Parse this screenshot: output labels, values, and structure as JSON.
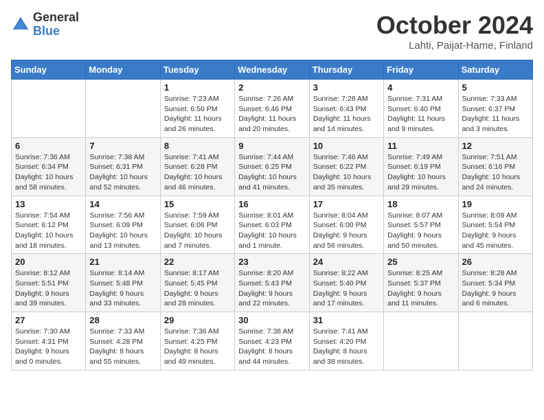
{
  "logo": {
    "general": "General",
    "blue": "Blue"
  },
  "header": {
    "month": "October 2024",
    "location": "Lahti, Paijat-Hame, Finland"
  },
  "weekdays": [
    "Sunday",
    "Monday",
    "Tuesday",
    "Wednesday",
    "Thursday",
    "Friday",
    "Saturday"
  ],
  "weeks": [
    [
      {
        "day": "",
        "info": ""
      },
      {
        "day": "",
        "info": ""
      },
      {
        "day": "1",
        "info": "Sunrise: 7:23 AM\nSunset: 6:50 PM\nDaylight: 11 hours and 26 minutes."
      },
      {
        "day": "2",
        "info": "Sunrise: 7:26 AM\nSunset: 6:46 PM\nDaylight: 11 hours and 20 minutes."
      },
      {
        "day": "3",
        "info": "Sunrise: 7:28 AM\nSunset: 6:43 PM\nDaylight: 11 hours and 14 minutes."
      },
      {
        "day": "4",
        "info": "Sunrise: 7:31 AM\nSunset: 6:40 PM\nDaylight: 11 hours and 9 minutes."
      },
      {
        "day": "5",
        "info": "Sunrise: 7:33 AM\nSunset: 6:37 PM\nDaylight: 11 hours and 3 minutes."
      }
    ],
    [
      {
        "day": "6",
        "info": "Sunrise: 7:36 AM\nSunset: 6:34 PM\nDaylight: 10 hours and 58 minutes."
      },
      {
        "day": "7",
        "info": "Sunrise: 7:38 AM\nSunset: 6:31 PM\nDaylight: 10 hours and 52 minutes."
      },
      {
        "day": "8",
        "info": "Sunrise: 7:41 AM\nSunset: 6:28 PM\nDaylight: 10 hours and 46 minutes."
      },
      {
        "day": "9",
        "info": "Sunrise: 7:44 AM\nSunset: 6:25 PM\nDaylight: 10 hours and 41 minutes."
      },
      {
        "day": "10",
        "info": "Sunrise: 7:46 AM\nSunset: 6:22 PM\nDaylight: 10 hours and 35 minutes."
      },
      {
        "day": "11",
        "info": "Sunrise: 7:49 AM\nSunset: 6:19 PM\nDaylight: 10 hours and 29 minutes."
      },
      {
        "day": "12",
        "info": "Sunrise: 7:51 AM\nSunset: 6:16 PM\nDaylight: 10 hours and 24 minutes."
      }
    ],
    [
      {
        "day": "13",
        "info": "Sunrise: 7:54 AM\nSunset: 6:12 PM\nDaylight: 10 hours and 18 minutes."
      },
      {
        "day": "14",
        "info": "Sunrise: 7:56 AM\nSunset: 6:09 PM\nDaylight: 10 hours and 13 minutes."
      },
      {
        "day": "15",
        "info": "Sunrise: 7:59 AM\nSunset: 6:06 PM\nDaylight: 10 hours and 7 minutes."
      },
      {
        "day": "16",
        "info": "Sunrise: 8:01 AM\nSunset: 6:03 PM\nDaylight: 10 hours and 1 minute."
      },
      {
        "day": "17",
        "info": "Sunrise: 8:04 AM\nSunset: 6:00 PM\nDaylight: 9 hours and 56 minutes."
      },
      {
        "day": "18",
        "info": "Sunrise: 8:07 AM\nSunset: 5:57 PM\nDaylight: 9 hours and 50 minutes."
      },
      {
        "day": "19",
        "info": "Sunrise: 8:09 AM\nSunset: 5:54 PM\nDaylight: 9 hours and 45 minutes."
      }
    ],
    [
      {
        "day": "20",
        "info": "Sunrise: 8:12 AM\nSunset: 5:51 PM\nDaylight: 9 hours and 39 minutes."
      },
      {
        "day": "21",
        "info": "Sunrise: 8:14 AM\nSunset: 5:48 PM\nDaylight: 9 hours and 33 minutes."
      },
      {
        "day": "22",
        "info": "Sunrise: 8:17 AM\nSunset: 5:45 PM\nDaylight: 9 hours and 28 minutes."
      },
      {
        "day": "23",
        "info": "Sunrise: 8:20 AM\nSunset: 5:43 PM\nDaylight: 9 hours and 22 minutes."
      },
      {
        "day": "24",
        "info": "Sunrise: 8:22 AM\nSunset: 5:40 PM\nDaylight: 9 hours and 17 minutes."
      },
      {
        "day": "25",
        "info": "Sunrise: 8:25 AM\nSunset: 5:37 PM\nDaylight: 9 hours and 11 minutes."
      },
      {
        "day": "26",
        "info": "Sunrise: 8:28 AM\nSunset: 5:34 PM\nDaylight: 9 hours and 6 minutes."
      }
    ],
    [
      {
        "day": "27",
        "info": "Sunrise: 7:30 AM\nSunset: 4:31 PM\nDaylight: 9 hours and 0 minutes."
      },
      {
        "day": "28",
        "info": "Sunrise: 7:33 AM\nSunset: 4:28 PM\nDaylight: 8 hours and 55 minutes."
      },
      {
        "day": "29",
        "info": "Sunrise: 7:36 AM\nSunset: 4:25 PM\nDaylight: 8 hours and 49 minutes."
      },
      {
        "day": "30",
        "info": "Sunrise: 7:38 AM\nSunset: 4:23 PM\nDaylight: 8 hours and 44 minutes."
      },
      {
        "day": "31",
        "info": "Sunrise: 7:41 AM\nSunset: 4:20 PM\nDaylight: 8 hours and 38 minutes."
      },
      {
        "day": "",
        "info": ""
      },
      {
        "day": "",
        "info": ""
      }
    ]
  ]
}
